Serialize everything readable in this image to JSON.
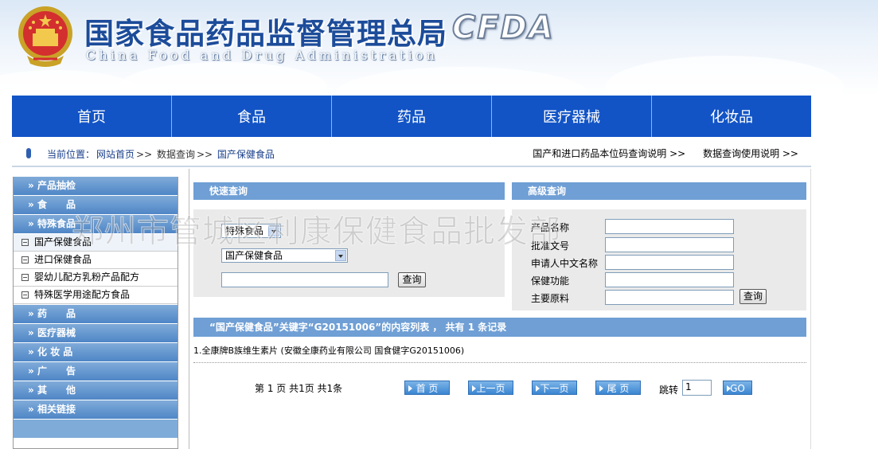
{
  "header": {
    "title_cn": "国家食品药品监督管理总局",
    "title_en": "China Food and Drug Administration",
    "logo": "CFDA",
    "emblem_icon": "national-emblem-icon"
  },
  "nav": {
    "items": [
      {
        "label": "首页"
      },
      {
        "label": "食品"
      },
      {
        "label": "药品"
      },
      {
        "label": "医疗器械"
      },
      {
        "label": "化妆品"
      }
    ]
  },
  "breadcrumb": {
    "prefix": "当前位置：",
    "items": [
      "网站首页",
      "数据查询",
      "国产保健食品"
    ],
    "separator": ">>",
    "links": [
      "国产和进口药品本位码查询说明 >>",
      "数据查询使用说明 >>"
    ]
  },
  "sidebar": {
    "categories_top": [
      {
        "label": "产品抽检"
      },
      {
        "label": "食　　品"
      },
      {
        "label": "特殊食品"
      }
    ],
    "sub_items": [
      {
        "label": "国产保健食品"
      },
      {
        "label": "进口保健食品"
      },
      {
        "label": "婴幼儿配方乳粉产品配方"
      },
      {
        "label": "特殊医学用途配方食品"
      }
    ],
    "categories_bottom": [
      {
        "label": "药　　品"
      },
      {
        "label": "医疗器械"
      },
      {
        "label": "化 妆 品"
      },
      {
        "label": "广　　告"
      },
      {
        "label": "其　　他"
      },
      {
        "label": "相关链接"
      }
    ],
    "bullet": "»"
  },
  "quick_search": {
    "title": "快速查询",
    "select1": "特殊食品",
    "select2": "国产保健食品",
    "keyword": "",
    "button": "查询"
  },
  "advanced_search": {
    "title": "高级查询",
    "fields": [
      {
        "label": "产品名称",
        "value": ""
      },
      {
        "label": "批准文号",
        "value": ""
      },
      {
        "label": "申请人中文名称",
        "value": ""
      },
      {
        "label": "保健功能",
        "value": ""
      },
      {
        "label": "主要原料",
        "value": ""
      }
    ],
    "button": "查询"
  },
  "results": {
    "header": "“国产保健食品”关键字“G20151006”的内容列表 ， 共有 1 条记录",
    "items": [
      "1.全康牌B族维生素片 (安徽全康药业有限公司 国食健字G20151006)"
    ]
  },
  "pager": {
    "info": "第 1 页 共1页 共1条",
    "buttons": [
      "首 页",
      "上一页",
      "下一页",
      "尾 页"
    ],
    "jump_label": "跳转",
    "jump_value": "1",
    "go": "GO"
  },
  "watermark": "郑州市管城区利康保健食品批发部",
  "colors": {
    "nav_bg": "#1254c6",
    "panel_head": "#6f9fd5",
    "title_blue": "#1c4c9a"
  }
}
